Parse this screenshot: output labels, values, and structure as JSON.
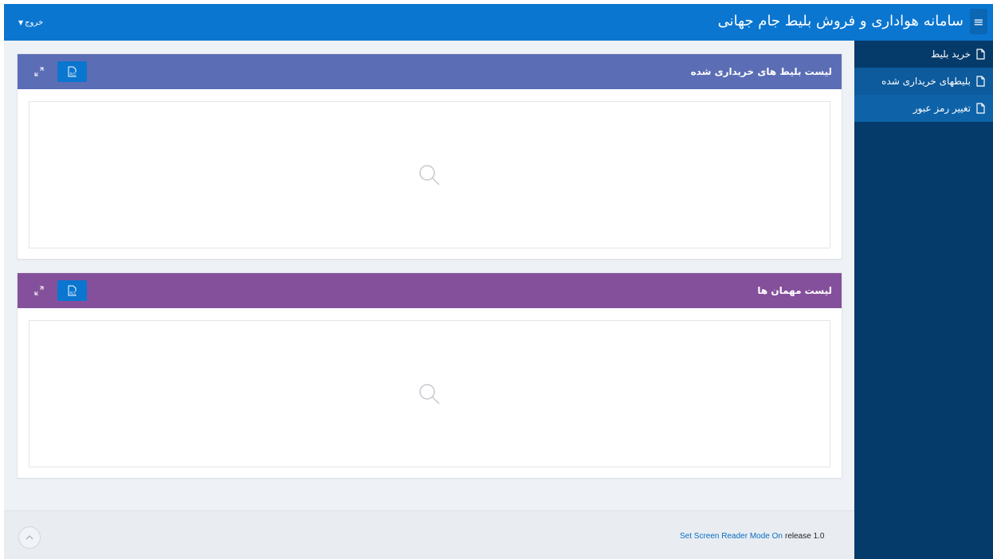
{
  "header": {
    "app_title": "سامانه هواداری و فروش بلیط جام جهانی",
    "menu_icon": "hamburger-icon",
    "logout_label": "خروج",
    "logout_caret": "▼"
  },
  "sidebar": {
    "items": [
      {
        "label": "خرید بلیط",
        "icon": "document-icon",
        "state": "selected"
      },
      {
        "label": "بلیطهای خریداری شده",
        "icon": "document-icon",
        "state": "current"
      },
      {
        "label": "تغییر رمز عبور",
        "icon": "document-icon",
        "state": "default"
      }
    ]
  },
  "regions": [
    {
      "title": "لیست بلیط های خریداری شده",
      "header_color": "#5b6db5",
      "body_icon": "search-icon"
    },
    {
      "title": "لیست مهمان ها",
      "header_color": "#84509b",
      "body_icon": "search-icon"
    }
  ],
  "footer": {
    "release_text": "release 1.0",
    "screen_reader_link": "Set Screen Reader Mode On"
  },
  "colors": {
    "brand": "#0a76d0",
    "sidebar": "#053b6a",
    "page_bg": "#eef1f5"
  }
}
